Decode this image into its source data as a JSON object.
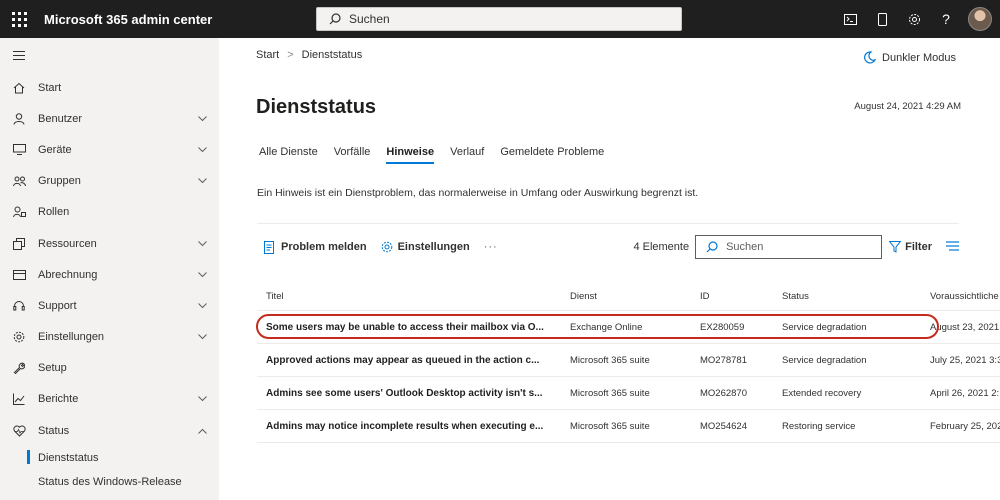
{
  "app": {
    "title": "Microsoft 365 admin center"
  },
  "search": {
    "placeholder": "Suchen"
  },
  "topbar_icons": [
    "terminal-icon",
    "phone-icon",
    "gear-icon",
    "help-icon",
    "avatar"
  ],
  "topbar_help": "?",
  "sidebar": {
    "items": [
      {
        "label": "Start",
        "icon": "home-icon",
        "chevron": false
      },
      {
        "label": "Benutzer",
        "icon": "user-icon",
        "chevron": true
      },
      {
        "label": "Geräte",
        "icon": "device-icon",
        "chevron": true
      },
      {
        "label": "Gruppen",
        "icon": "groups-icon",
        "chevron": true
      },
      {
        "label": "Rollen",
        "icon": "roles-icon",
        "chevron": false
      },
      {
        "label": "Ressourcen",
        "icon": "resources-icon",
        "chevron": true
      },
      {
        "label": "Abrechnung",
        "icon": "billing-icon",
        "chevron": true
      },
      {
        "label": "Support",
        "icon": "headset-icon",
        "chevron": true
      },
      {
        "label": "Einstellungen",
        "icon": "gear-icon",
        "chevron": true
      },
      {
        "label": "Setup",
        "icon": "wrench-icon",
        "chevron": false
      },
      {
        "label": "Berichte",
        "icon": "chart-icon",
        "chevron": true
      },
      {
        "label": "Status",
        "icon": "heart-icon",
        "chevron": true,
        "expanded": true
      }
    ],
    "sub_items": [
      {
        "label": "Dienststatus",
        "active": true
      },
      {
        "label": "Status des Windows-Release",
        "active": false
      }
    ]
  },
  "breadcrumb": {
    "home": "Start",
    "separator": ">",
    "current": "Dienststatus"
  },
  "dark_mode_label": "Dunkler Modus",
  "page": {
    "title": "Dienststatus",
    "timestamp": "August 24, 2021 4:29 AM"
  },
  "tabs": [
    {
      "label": "Alle Dienste",
      "active": false
    },
    {
      "label": "Vorfälle",
      "active": false
    },
    {
      "label": "Hinweise",
      "active": true
    },
    {
      "label": "Verlauf",
      "active": false
    },
    {
      "label": "Gemeldete Probleme",
      "active": false
    }
  ],
  "info_text": "Ein Hinweis ist ein Dienstproblem, das normalerweise in Umfang oder Auswirkung begrenzt ist.",
  "toolbar": {
    "report_label": "Problem melden",
    "settings_label": "Einstellungen",
    "more": "···",
    "count": "4 Elemente",
    "search_placeholder": "Suchen",
    "filter_label": "Filter"
  },
  "table": {
    "headers": [
      "Titel",
      "Dienst",
      "ID",
      "Status",
      "Voraussichtliche"
    ],
    "rows": [
      {
        "title": "Some users may be unable to access their mailbox via O...",
        "service": "Exchange Online",
        "id": "EX280059",
        "status": "Service degradation",
        "estimate": "August 23, 2021",
        "highlighted": true
      },
      {
        "title": "Approved actions may appear as queued in the action c...",
        "service": "Microsoft 365 suite",
        "id": "MO278781",
        "status": "Service degradation",
        "estimate": "July 25, 2021 3:3",
        "highlighted": false
      },
      {
        "title": "Admins see some users' Outlook Desktop activity isn't s...",
        "service": "Microsoft 365 suite",
        "id": "MO262870",
        "status": "Extended recovery",
        "estimate": "April 26, 2021 2:",
        "highlighted": false
      },
      {
        "title": "Admins may notice incomplete results when executing e...",
        "service": "Microsoft 365 suite",
        "id": "MO254624",
        "status": "Restoring service",
        "estimate": "February 25, 202",
        "highlighted": false
      }
    ]
  },
  "colors": {
    "accent": "#0078d4",
    "highlight": "#c42b1c",
    "topbar": "#1f1f1f",
    "sidebar": "#f3f2f1"
  }
}
